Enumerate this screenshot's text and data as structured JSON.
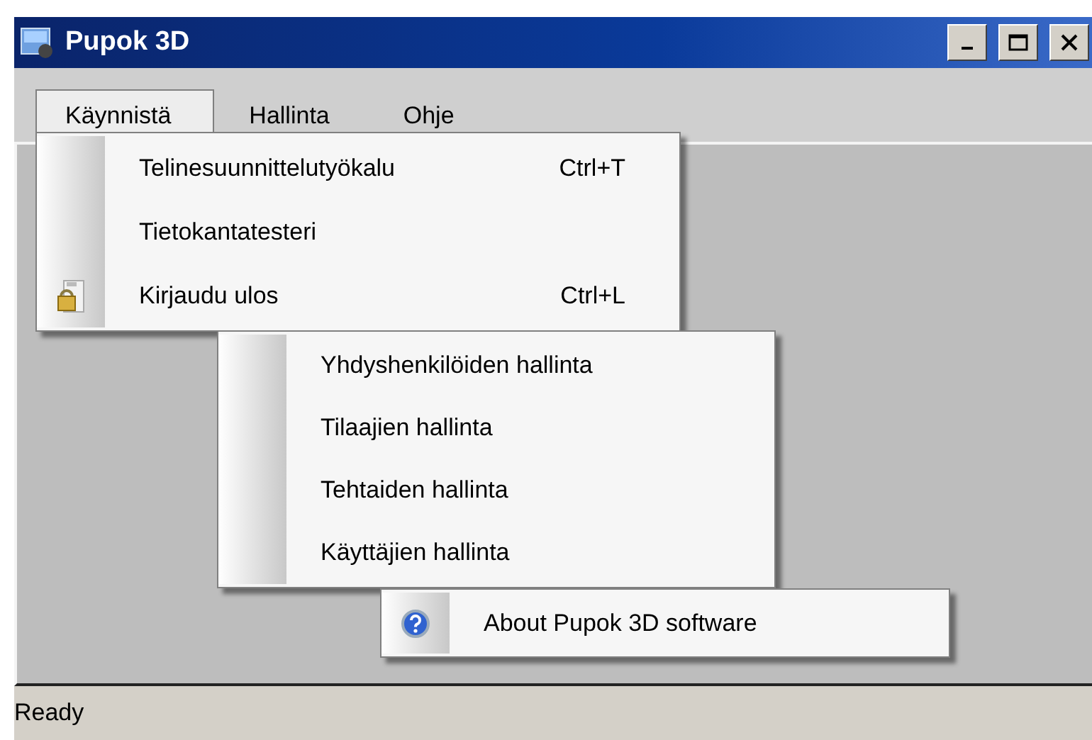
{
  "window": {
    "title": "Pupok 3D"
  },
  "menu_bar": [
    {
      "label": "Käynnistä",
      "selected": true
    },
    {
      "label": "Hallinta",
      "selected": false
    },
    {
      "label": "Ohje",
      "selected": false
    }
  ],
  "menus": [
    {
      "items": [
        {
          "label": "Telinesuunnittelutyökalu",
          "shortcut": "Ctrl+T"
        },
        {
          "label": "Tietokantatesteri"
        },
        {
          "label": "Kirjaudu ulos",
          "shortcut": "Ctrl+L",
          "has_icon": true
        }
      ]
    },
    {
      "items": [
        {
          "label": "Yhdyshenkilöiden hallinta"
        },
        {
          "label": "Tilaajien hallinta"
        },
        {
          "label": "Tehtaiden hallinta"
        },
        {
          "label": "Käyttäjien hallinta"
        }
      ]
    },
    {
      "items": [
        {
          "label": "About Pupok 3D software",
          "has_icon": true
        }
      ]
    }
  ],
  "status_bar": {
    "text": "Ready"
  }
}
